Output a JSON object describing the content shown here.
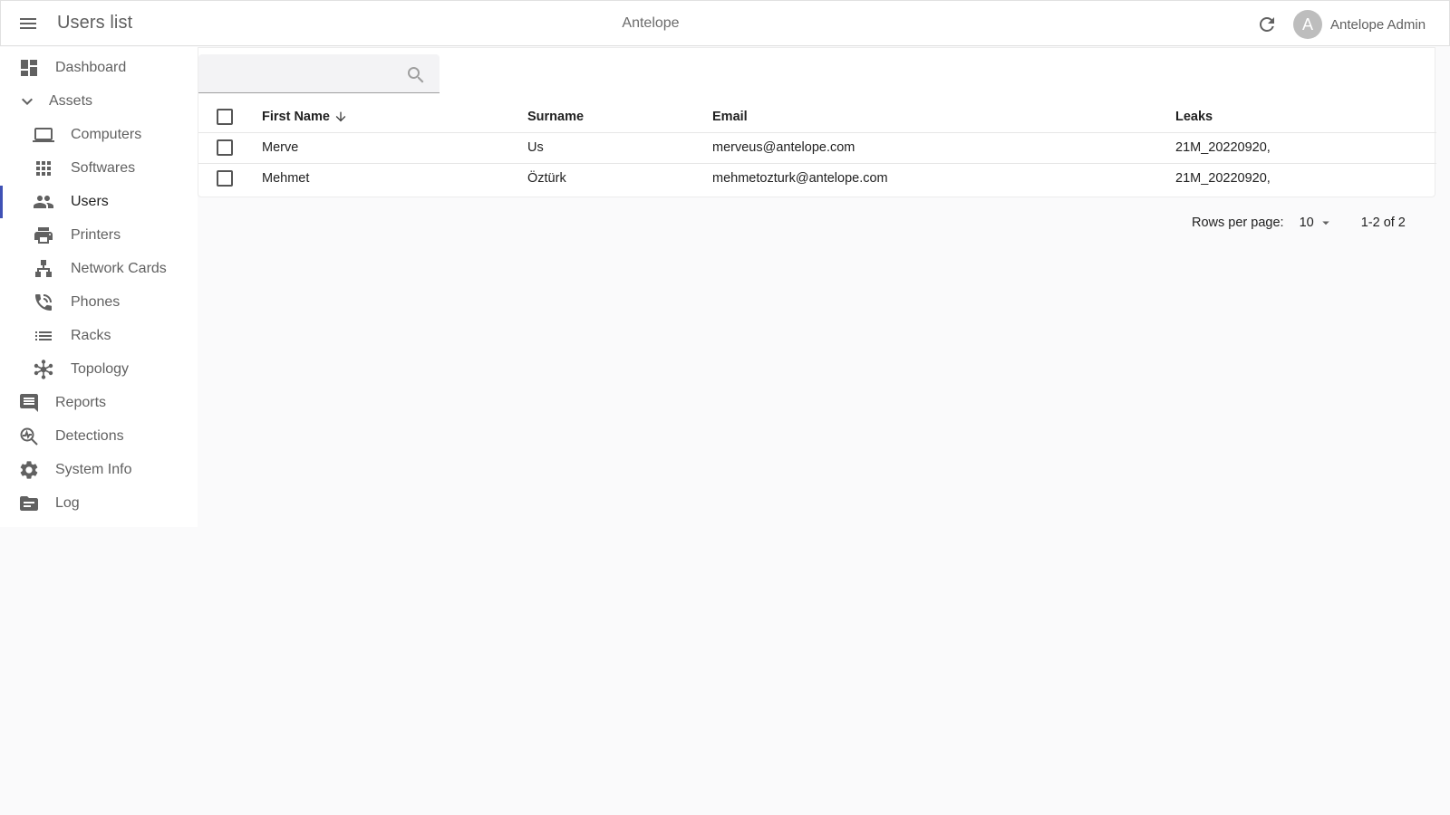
{
  "header": {
    "page_title": "Users list",
    "app_name": "Antelope",
    "user_initial": "A",
    "user_name": "Antelope Admin",
    "icons": [
      "menu-icon",
      "refresh-icon"
    ]
  },
  "sidebar": {
    "items": [
      {
        "label": "Dashboard",
        "icon": "dashboard-icon"
      },
      {
        "label": "Assets",
        "icon": "chevron-down-icon",
        "expanded": true
      },
      {
        "label": "Computers",
        "icon": "laptop-icon"
      },
      {
        "label": "Softwares",
        "icon": "apps-grid-icon"
      },
      {
        "label": "Users",
        "icon": "people-icon",
        "active": true
      },
      {
        "label": "Printers",
        "icon": "printer-icon"
      },
      {
        "label": "Network Cards",
        "icon": "network-icon"
      },
      {
        "label": "Phones",
        "icon": "phone-icon"
      },
      {
        "label": "Racks",
        "icon": "list-icon"
      },
      {
        "label": "Topology",
        "icon": "hub-icon"
      },
      {
        "label": "Reports",
        "icon": "comment-icon"
      },
      {
        "label": "Detections",
        "icon": "search-insights-icon"
      },
      {
        "label": "System Info",
        "icon": "gear-icon"
      },
      {
        "label": "Log",
        "icon": "folder-icon"
      }
    ]
  },
  "search": {
    "value": "",
    "placeholder": ""
  },
  "table": {
    "columns": [
      "First Name",
      "Surname",
      "Email",
      "Leaks"
    ],
    "sort": {
      "column": "First Name",
      "direction": "desc"
    },
    "rows": [
      {
        "first_name": "Merve",
        "surname": "Us",
        "email": "merveus@antelope.com",
        "leaks": "21M_20220920,",
        "selected": false
      },
      {
        "first_name": "Mehmet",
        "surname": "Öztürk",
        "email": "mehmetozturk@antelope.com",
        "leaks": "21M_20220920,",
        "selected": false
      }
    ]
  },
  "pagination": {
    "rows_per_page_label": "Rows per page:",
    "rows_per_page": "10",
    "range": "1-2 of 2"
  },
  "colors": {
    "accent": "#3f51b5",
    "text_secondary": "#616161",
    "background": "#fafafb"
  }
}
